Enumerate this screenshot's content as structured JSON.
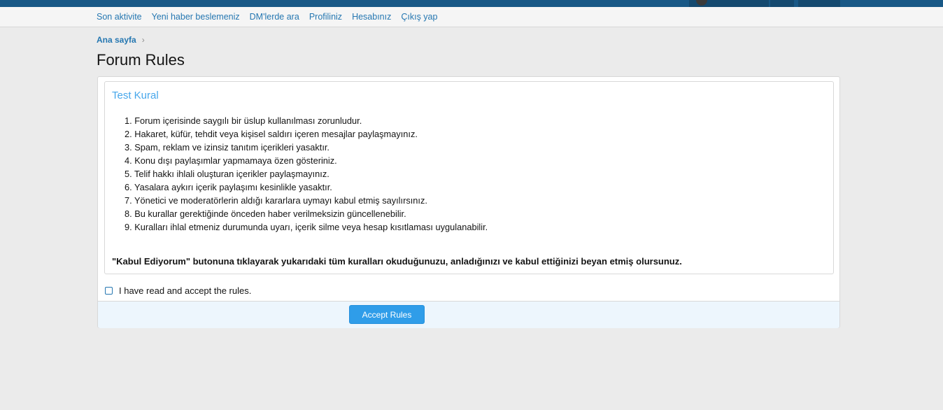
{
  "subnav": {
    "items": [
      "Son aktivite",
      "Yeni haber beslemeniz",
      "DM'lerde ara",
      "Profiliniz",
      "Hesabınız",
      "Çıkış yap"
    ]
  },
  "breadcrumb": {
    "home": "Ana sayfa",
    "separator": "›"
  },
  "page": {
    "title": "Forum Rules"
  },
  "rules": {
    "title": "Test Kural",
    "items": [
      "1. Forum içerisinde saygılı bir üslup kullanılması zorunludur.",
      "2. Hakaret, küfür, tehdit veya kişisel saldırı içeren mesajlar paylaşmayınız.",
      "3. Spam, reklam ve izinsiz tanıtım içerikleri yasaktır.",
      "4. Konu dışı paylaşımlar yapmamaya özen gösteriniz.",
      "5. Telif hakkı ihlali oluşturan içerikler paylaşmayınız.",
      "6. Yasalara aykırı içerik paylaşımı kesinlikle yasaktır.",
      "7. Yönetici ve moderatörlerin aldığı kararlara uymayı kabul etmiş sayılırsınız.",
      "8. Bu kurallar gerektiğinde önceden haber verilmeksizin güncellenebilir.",
      "9. Kuralları ihlal etmeniz durumunda uyarı, içerik silme veya hesap kısıtlaması uygulanabilir."
    ],
    "note": "\"Kabul Ediyorum\" butonuna tıklayarak yukarıdaki tüm kuralları okuduğunuzu, anladığınızı ve kabul ettiğinizi beyan etmiş olursunuz."
  },
  "accept": {
    "checkbox_label": "I have read and accept the rules.",
    "button_label": "Accept Rules"
  },
  "colors": {
    "topbar": "#185886",
    "link": "#2577b1",
    "accent_title": "#47a7eb",
    "button": "#2f9de9",
    "footer_bg": "#edf6fd"
  }
}
